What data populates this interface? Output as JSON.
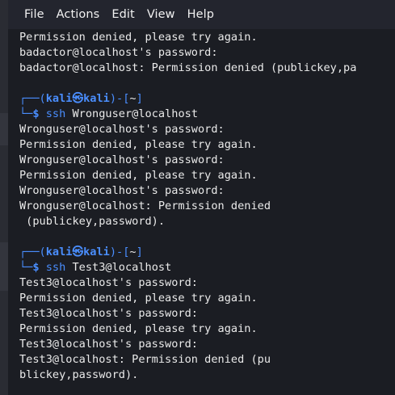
{
  "menubar": {
    "items": [
      "File",
      "Actions",
      "Edit",
      "View",
      "Help"
    ]
  },
  "prompt": {
    "user": "kali",
    "at_symbol": "㉿",
    "host": "kali",
    "dir": "~",
    "dollar": "$"
  },
  "lines": [
    {
      "type": "out",
      "text": "Permission denied, please try again."
    },
    {
      "type": "out",
      "text": "badactor@localhost's password:"
    },
    {
      "type": "out",
      "text": "badactor@localhost: Permission denied (publickey,pa"
    },
    {
      "type": "blank",
      "text": ""
    },
    {
      "type": "prompt1",
      "text": ""
    },
    {
      "type": "prompt2",
      "cmd": "ssh",
      "arg": "Wronguser@localhost"
    },
    {
      "type": "out",
      "text": "Wronguser@localhost's password:"
    },
    {
      "type": "out",
      "text": "Permission denied, please try again."
    },
    {
      "type": "out",
      "text": "Wronguser@localhost's password:"
    },
    {
      "type": "out",
      "text": "Permission denied, please try again."
    },
    {
      "type": "out",
      "text": "Wronguser@localhost's password:"
    },
    {
      "type": "out",
      "text": "Wronguser@localhost: Permission denied"
    },
    {
      "type": "out",
      "text": " (publickey,password)."
    },
    {
      "type": "blank",
      "text": ""
    },
    {
      "type": "prompt1",
      "text": ""
    },
    {
      "type": "prompt2",
      "cmd": "ssh",
      "arg": "Test3@localhost"
    },
    {
      "type": "out",
      "text": "Test3@localhost's password:"
    },
    {
      "type": "out",
      "text": "Permission denied, please try again."
    },
    {
      "type": "out",
      "text": "Test3@localhost's password:"
    },
    {
      "type": "out",
      "text": "Permission denied, please try again."
    },
    {
      "type": "out",
      "text": "Test3@localhost's password:"
    },
    {
      "type": "out",
      "text": "Test3@localhost: Permission denied (pu"
    },
    {
      "type": "out",
      "text": "blickey,password)."
    }
  ]
}
